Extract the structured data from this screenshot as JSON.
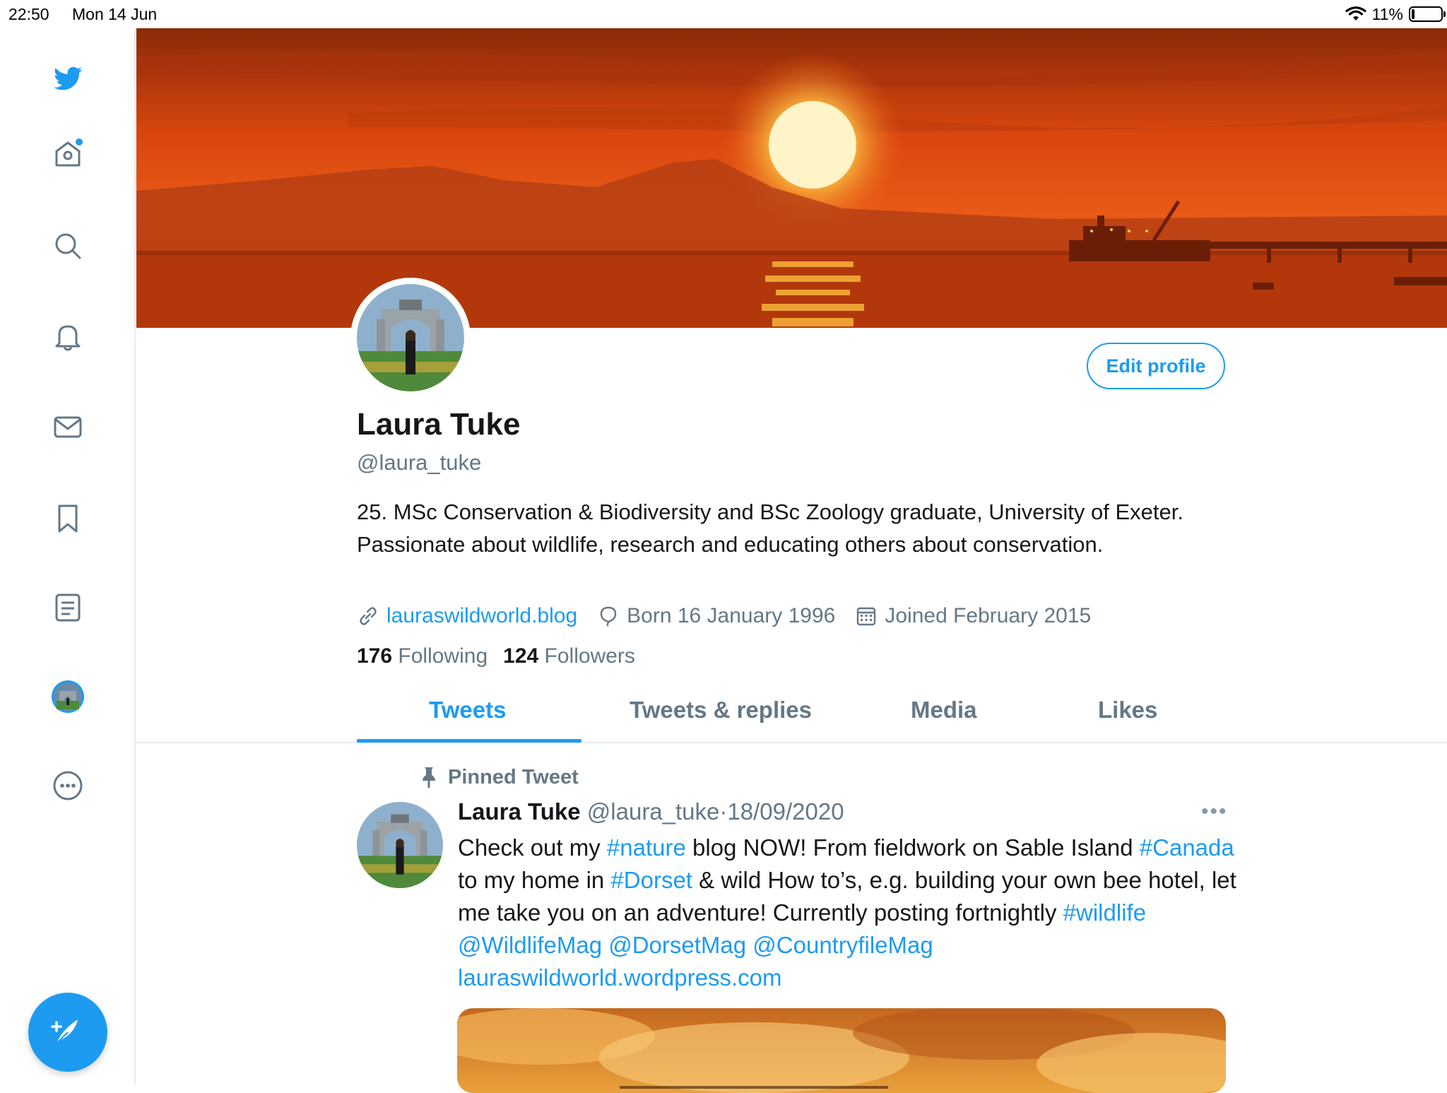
{
  "status_bar": {
    "time": "22:50",
    "date": "Mon 14 Jun",
    "battery_percent": "11%",
    "battery_level": 0.11
  },
  "sidebar": {
    "items": [
      {
        "name": "twitter-logo",
        "icon": "twitter-bird-icon"
      },
      {
        "name": "home",
        "icon": "home-icon",
        "has_notification_dot": true
      },
      {
        "name": "explore",
        "icon": "search-icon"
      },
      {
        "name": "notifications",
        "icon": "bell-icon"
      },
      {
        "name": "messages",
        "icon": "mail-icon"
      },
      {
        "name": "bookmarks",
        "icon": "bookmark-icon"
      },
      {
        "name": "lists",
        "icon": "list-icon"
      },
      {
        "name": "profile",
        "icon": "avatar"
      },
      {
        "name": "more",
        "icon": "more-circle-icon"
      }
    ],
    "compose_icon": "compose-feather-icon"
  },
  "profile": {
    "edit_label": "Edit profile",
    "display_name": "Laura Tuke",
    "handle": "@laura_tuke",
    "bio": "25. MSc Conservation & Biodiversity and BSc Zoology graduate, University of Exeter. Passionate about wildlife, research and educating others about conservation.",
    "website": "lauraswildworld.blog",
    "birthday": "Born 16 January 1996",
    "joined": "Joined February 2015",
    "following_count": "176",
    "following_label": "Following",
    "followers_count": "124",
    "followers_label": "Followers"
  },
  "tabs": [
    {
      "label": "Tweets",
      "active": true
    },
    {
      "label": "Tweets & replies",
      "active": false
    },
    {
      "label": "Media",
      "active": false
    },
    {
      "label": "Likes",
      "active": false
    }
  ],
  "pinned_tweet": {
    "pinned_label": "Pinned Tweet",
    "author": "Laura Tuke",
    "handle": "@laura_tuke",
    "separator": "·",
    "date": "18/09/2020",
    "more": "•••",
    "text": {
      "p1": "Check out my ",
      "h1": "#nature",
      "p2": " blog NOW! From fieldwork on Sable Island ",
      "h2": "#Canada",
      "p3": " to my home in ",
      "h3": "#Dorset",
      "p4": " & wild How to’s, e.g. building your own bee hotel, let me take you on an adventure! Currently posting fortnightly ",
      "h4": "#wildlife",
      "sp1": " ",
      "m1": "@WildlifeMag",
      "sp2": " ",
      "m2": "@DorsetMag",
      "sp3": " ",
      "m3": "@CountryfileMag",
      "link": "lauraswildworld.wordpress.com"
    }
  },
  "colors": {
    "accent": "#1d9bf0",
    "secondary_text": "#657786",
    "border": "#e6ecf0"
  }
}
